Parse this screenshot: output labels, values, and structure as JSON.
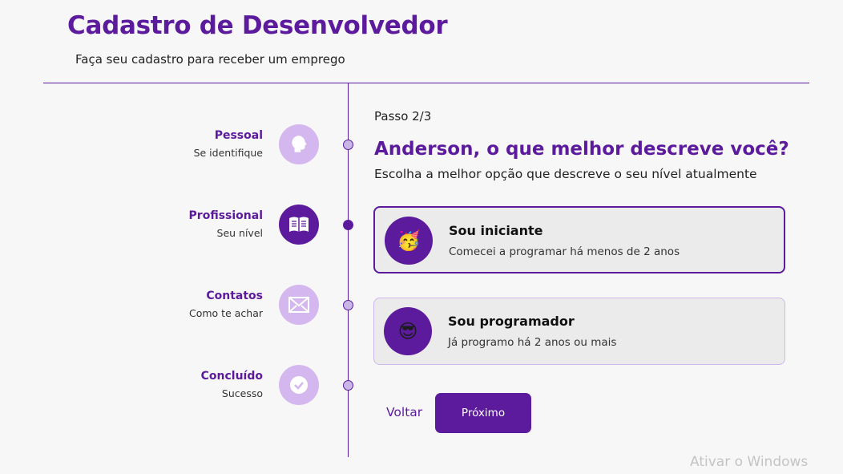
{
  "header": {
    "title": "Cadastro de Desenvolvedor",
    "subtitle": "Faça seu cadastro para receber um emprego"
  },
  "steps": [
    {
      "title": "Pessoal",
      "subtitle": "Se identifique",
      "icon": "speech-head-icon",
      "active": false
    },
    {
      "title": "Profissional",
      "subtitle": "Seu nível",
      "icon": "book-icon",
      "active": true
    },
    {
      "title": "Contatos",
      "subtitle": "Como te achar",
      "icon": "envelope-icon",
      "active": false
    },
    {
      "title": "Concluído",
      "subtitle": "Sucesso",
      "icon": "check-icon",
      "active": false
    }
  ],
  "form": {
    "step_counter": "Passo 2/3",
    "question": "Anderson, o que melhor descreve você?",
    "hint": "Escolha a melhor opção que descreve o seu nível atualmente",
    "options": [
      {
        "title": "Sou iniciante",
        "description": "Comecei a programar há menos de 2 anos",
        "emoji": "🥳",
        "selected": true
      },
      {
        "title": "Sou programador",
        "description": "Já programo há 2 anos ou mais",
        "emoji": "😎",
        "selected": false
      }
    ],
    "back_label": "Voltar",
    "next_label": "Próximo"
  },
  "watermark": "Ativar o Windows",
  "colors": {
    "primary": "#5c1a9c",
    "light": "#d4b7ef",
    "background": "#f7f7f7"
  }
}
